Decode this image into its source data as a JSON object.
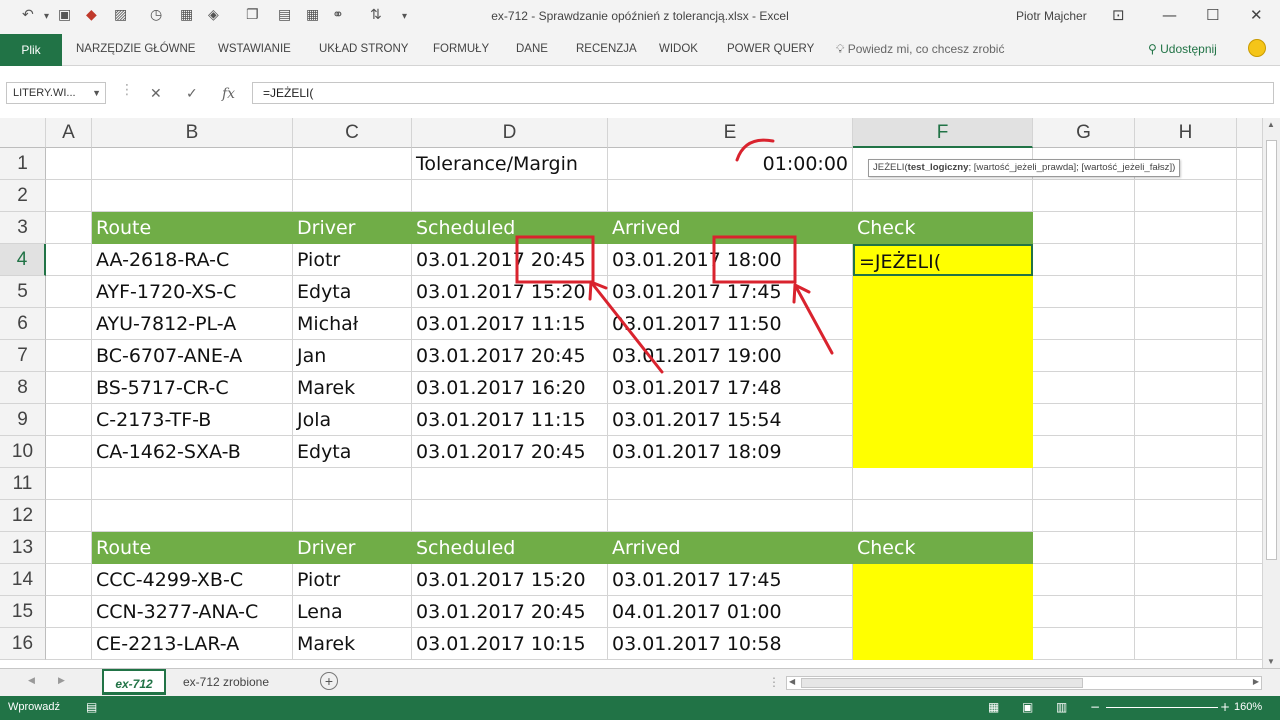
{
  "titlebar": {
    "title": "ex-712 - Sprawdzanie opóźnień z tolerancją.xlsx - Excel",
    "user": "Piotr Majcher"
  },
  "ribbon": {
    "file_tab": "Plik",
    "tabs": [
      "NARZĘDZIE GŁÓWNE",
      "WSTAWIANIE",
      "UKŁAD STRONY",
      "FORMUŁY",
      "DANE",
      "RECENZJA",
      "WIDOK",
      "POWER QUERY"
    ],
    "tell_me": "Powiedz mi, co chcesz zrobić",
    "share": "Udostępnij"
  },
  "formula_bar": {
    "name_box": "LITERY.WI...",
    "formula": "=JEŻELI("
  },
  "columns": [
    "A",
    "B",
    "C",
    "D",
    "E",
    "F",
    "G",
    "H"
  ],
  "rows": [
    "1",
    "2",
    "3",
    "4",
    "5",
    "6",
    "7",
    "8",
    "9",
    "10",
    "11",
    "12",
    "13",
    "14",
    "15",
    "16"
  ],
  "cells": {
    "d1": "Tolerance/Margin",
    "e1": "01:00:00",
    "headers": [
      "Route",
      "Driver",
      "Scheduled",
      "Arrived",
      "Check"
    ],
    "table1": [
      [
        "AA-2618-RA-C",
        "Piotr",
        "03.01.2017 20:45",
        "03.01.2017 18:00"
      ],
      [
        "AYF-1720-XS-C",
        "Edyta",
        "03.01.2017 15:20",
        "03.01.2017 17:45"
      ],
      [
        "AYU-7812-PL-A",
        "Michał",
        "03.01.2017 11:15",
        "03.01.2017 11:50"
      ],
      [
        "BC-6707-ANE-A",
        "Jan",
        "03.01.2017 20:45",
        "03.01.2017 19:00"
      ],
      [
        "BS-5717-CR-C",
        "Marek",
        "03.01.2017 16:20",
        "03.01.2017 17:48"
      ],
      [
        "C-2173-TF-B",
        "Jola",
        "03.01.2017 11:15",
        "03.01.2017 15:54"
      ],
      [
        "CA-1462-SXA-B",
        "Edyta",
        "03.01.2017 20:45",
        "03.01.2017 18:09"
      ]
    ],
    "table2": [
      [
        "CCC-4299-XB-C",
        "Piotr",
        "03.01.2017 15:20",
        "03.01.2017 17:45"
      ],
      [
        "CCN-3277-ANA-C",
        "Lena",
        "03.01.2017 20:45",
        "04.01.2017 01:00"
      ],
      [
        "CE-2213-LAR-A",
        "Marek",
        "03.01.2017 10:15",
        "03.01.2017 10:58"
      ]
    ],
    "active_cell_text": "=JEŻELI("
  },
  "tooltip": {
    "fn": "JEŻELI(",
    "arg1": "test_logiczny",
    "rest": "; [wartość_jeżeli_prawda]; [wartość_jeżeli_fałsz])"
  },
  "sheets": [
    "ex-712",
    "ex-712 zrobione"
  ],
  "status": {
    "mode": "Wprowadź",
    "zoom": "160%"
  },
  "colors": {
    "excel_green": "#217346",
    "header_green": "#70ad47",
    "highlight_yellow": "#ffff00",
    "annotation_red": "#d9232e"
  }
}
